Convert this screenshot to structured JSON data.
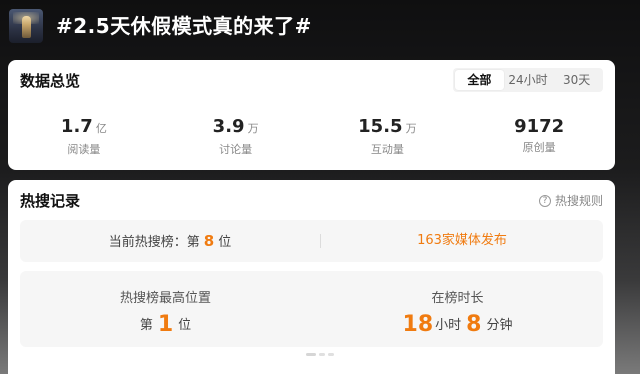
{
  "topic": {
    "title": "#2.5天休假模式真的来了#"
  },
  "overview": {
    "title": "数据总览",
    "tabs": [
      {
        "label": "全部",
        "active": true
      },
      {
        "label": "24小时",
        "active": false
      },
      {
        "label": "30天",
        "active": false
      }
    ],
    "stats": [
      {
        "value": "1.7",
        "unit": "亿",
        "label": "阅读量"
      },
      {
        "value": "3.9",
        "unit": "万",
        "label": "讨论量"
      },
      {
        "value": "15.5",
        "unit": "万",
        "label": "互动量"
      },
      {
        "value": "9172",
        "unit": "",
        "label": "原创量"
      }
    ]
  },
  "hot_search": {
    "title": "热搜记录",
    "rules_label": "热搜规则",
    "current_prefix": "当前热搜榜：第",
    "current_rank": "8",
    "current_suffix": "位",
    "media_text": "163家媒体发布",
    "highest_label": "热搜榜最高位置",
    "highest_prefix": "第",
    "highest_rank": "1",
    "highest_suffix": "位",
    "duration_label": "在榜时长",
    "duration_hours": "18",
    "duration_hours_unit": "小时",
    "duration_minutes": "8",
    "duration_minutes_unit": "分钟"
  },
  "colors": {
    "accent": "#f07b10"
  }
}
